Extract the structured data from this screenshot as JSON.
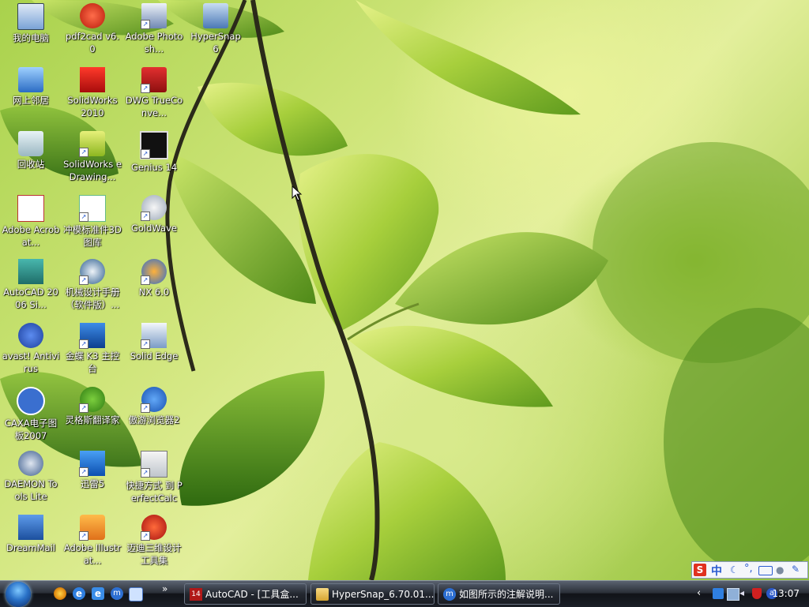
{
  "desktop_icons": [
    {
      "id": "my-computer",
      "label": "我的电脑",
      "icon": "computer-icon",
      "shortcut": false
    },
    {
      "id": "network-places",
      "label": "网上邻居",
      "icon": "network-icon",
      "shortcut": false
    },
    {
      "id": "recycle-bin",
      "label": "回收站",
      "icon": "recycle-bin-icon",
      "shortcut": false
    },
    {
      "id": "adobe-acrobat",
      "label": "Adobe Acrobat...",
      "icon": "acrobat-icon",
      "shortcut": false
    },
    {
      "id": "autocad-2006",
      "label": "AutoCAD 2006 Si...",
      "icon": "autocad-icon",
      "shortcut": false
    },
    {
      "id": "avast",
      "label": "avast! Antivirus",
      "icon": "avast-icon",
      "shortcut": false
    },
    {
      "id": "caxa",
      "label": "CAXA电子图板2007",
      "icon": "caxa-icon",
      "shortcut": false
    },
    {
      "id": "daemon-tools",
      "label": "DAEMON Tools Lite",
      "icon": "daemon-tools-icon",
      "shortcut": false
    },
    {
      "id": "dreammail",
      "label": "DreamMail",
      "icon": "dreammail-icon",
      "shortcut": false
    },
    {
      "id": "pdf2cad",
      "label": "pdf2cad v6.0",
      "icon": "pdf2cad-icon",
      "shortcut": false
    },
    {
      "id": "solidworks-2010",
      "label": "SolidWorks 2010",
      "icon": "solidworks-icon",
      "shortcut": false
    },
    {
      "id": "solidworks-edrawings",
      "label": "SolidWorks eDrawing...",
      "icon": "edrawings-icon",
      "shortcut": true
    },
    {
      "id": "punch-parts",
      "label": "冲模标准件3D图库",
      "icon": "punch-library-icon",
      "shortcut": true
    },
    {
      "id": "mech-design",
      "label": "机械设计手册（软件版）...",
      "icon": "mech-handbook-icon",
      "shortcut": true
    },
    {
      "id": "kingdee-k3",
      "label": "金蝶 K3 主控台",
      "icon": "kingdee-icon",
      "shortcut": true
    },
    {
      "id": "lingoes",
      "label": "灵格斯翻译家",
      "icon": "lingoes-icon",
      "shortcut": true
    },
    {
      "id": "thunder5",
      "label": "迅雷5",
      "icon": "thunder-icon",
      "shortcut": true
    },
    {
      "id": "adobe-illustrator",
      "label": "Adobe Illustrat...",
      "icon": "illustrator-icon",
      "shortcut": true
    },
    {
      "id": "adobe-photoshop",
      "label": "Adobe Photosh...",
      "icon": "photoshop-icon",
      "shortcut": true
    },
    {
      "id": "dwg-trueconvert",
      "label": "DWG TrueConve...",
      "icon": "dwg-convert-icon",
      "shortcut": true
    },
    {
      "id": "genius14",
      "label": "Genius 14",
      "icon": "genius-icon",
      "shortcut": true
    },
    {
      "id": "goldwave",
      "label": "GoldWave",
      "icon": "goldwave-icon",
      "shortcut": true
    },
    {
      "id": "nx6",
      "label": "NX 6.0",
      "icon": "nx-icon",
      "shortcut": true
    },
    {
      "id": "solid-edge",
      "label": "Solid Edge",
      "icon": "solid-edge-icon",
      "shortcut": true
    },
    {
      "id": "maxthon2",
      "label": "傲游浏览器2",
      "icon": "maxthon-icon",
      "shortcut": true
    },
    {
      "id": "perfectcalc",
      "label": "快捷方式 到 PerfectCalc",
      "icon": "calculator-icon",
      "shortcut": true
    },
    {
      "id": "maidi-tools",
      "label": "迈迪三维设计工具集",
      "icon": "maidi-icon",
      "shortcut": true
    },
    {
      "id": "hypersnap6",
      "label": "HyperSnap 6",
      "icon": "hypersnap-icon",
      "shortcut": false
    }
  ],
  "taskbar": {
    "start_icon": "windows-orb-icon",
    "quick_launch": [
      "media-player-icon",
      "ie-icon",
      "ie-alt-icon",
      "maxthon-small-icon",
      "show-desktop-icon"
    ],
    "overflow": "»",
    "tasks": [
      {
        "label": "AutoCAD - [工具盒...",
        "icon": "autocad-task-icon"
      },
      {
        "label": "HyperSnap_6.70.01...",
        "icon": "folder-icon"
      },
      {
        "label": "如图所示的注解说明...",
        "icon": "maxthon-task-icon"
      }
    ],
    "tray_icons": [
      "chevron-left-icon",
      "ie-tray-icon",
      "network-tray-icon",
      "sound-tray-icon",
      "security-tray-icon",
      "avast-tray-icon"
    ],
    "clock": "13:07"
  },
  "ime_bar": {
    "logo": "S",
    "mode": "中",
    "icons": [
      "moon-icon",
      "punctuation-icon",
      "keyboard-icon",
      "user-icon",
      "wrench-icon"
    ]
  },
  "colors": {
    "taskbar_dark": "#101318",
    "desktop_green": "#a9d24c",
    "label_white": "#ffffff"
  }
}
